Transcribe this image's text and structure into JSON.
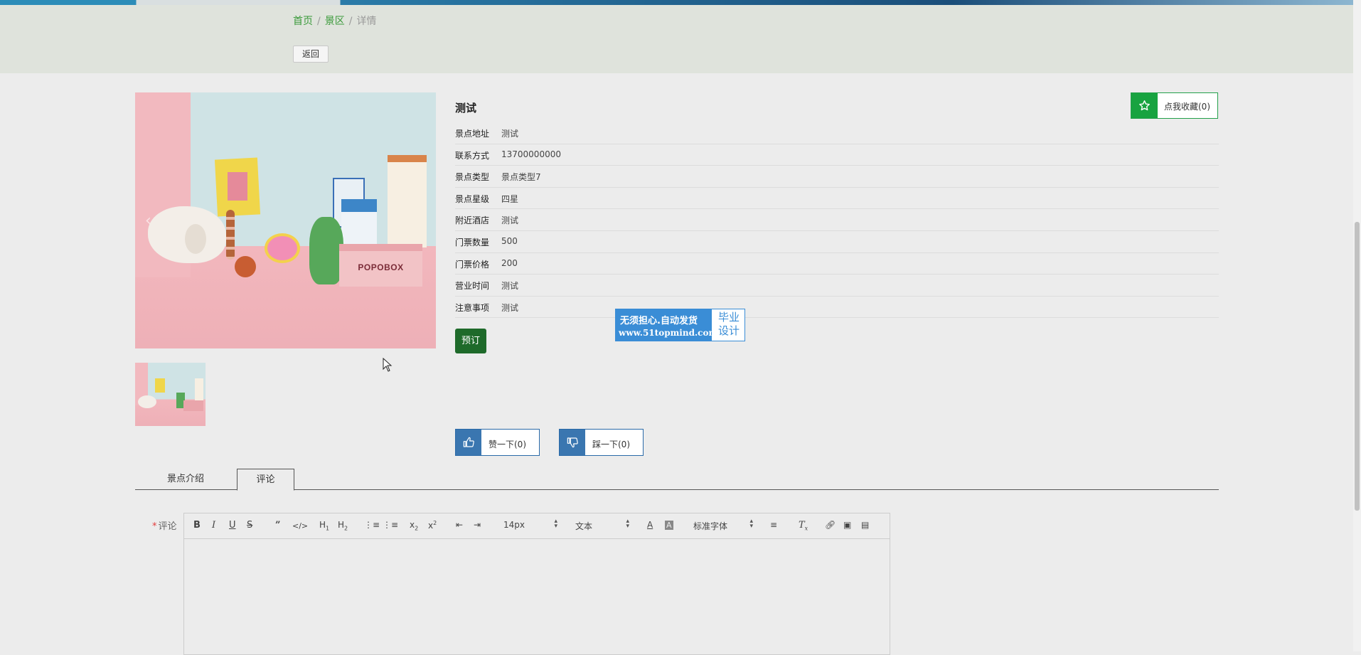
{
  "breadcrumb": {
    "home": "首页",
    "scenic": "景区",
    "current": "详情",
    "sep": "/"
  },
  "back_label": "返回",
  "detail": {
    "title": "测试",
    "favorite_label": "点我收藏(0)",
    "fields": [
      {
        "label": "景点地址",
        "value": "测试"
      },
      {
        "label": "联系方式",
        "value": "13700000000"
      },
      {
        "label": "景点类型",
        "value": "景点类型7"
      },
      {
        "label": "景点星级",
        "value": "四星"
      },
      {
        "label": "附近酒店",
        "value": "测试"
      },
      {
        "label": "门票数量",
        "value": "500"
      },
      {
        "label": "门票价格",
        "value": "200"
      },
      {
        "label": "营业时间",
        "value": "测试"
      },
      {
        "label": "注意事项",
        "value": "测试"
      }
    ],
    "book_label": "预订",
    "like_label": "赞一下(0)",
    "dislike_label": "踩一下(0)"
  },
  "image": {
    "box_brand": "POPOBOX"
  },
  "watermark": {
    "line1": "无须担心.自动发货",
    "line2": "www.51topmind.com",
    "right1": "毕业",
    "right2": "设计"
  },
  "tabs": {
    "intro": "景点介绍",
    "comment": "评论"
  },
  "comment": {
    "required_mark": "*",
    "label": "评论",
    "toolbar": {
      "font_size": "14px",
      "heading_style": "文本",
      "font_family": "标准字体"
    }
  },
  "colors": {
    "accent_green": "#18a340",
    "dark_green": "#1e6a2a",
    "vote_blue": "#3a76b0",
    "link_green": "#3a9a3a"
  }
}
